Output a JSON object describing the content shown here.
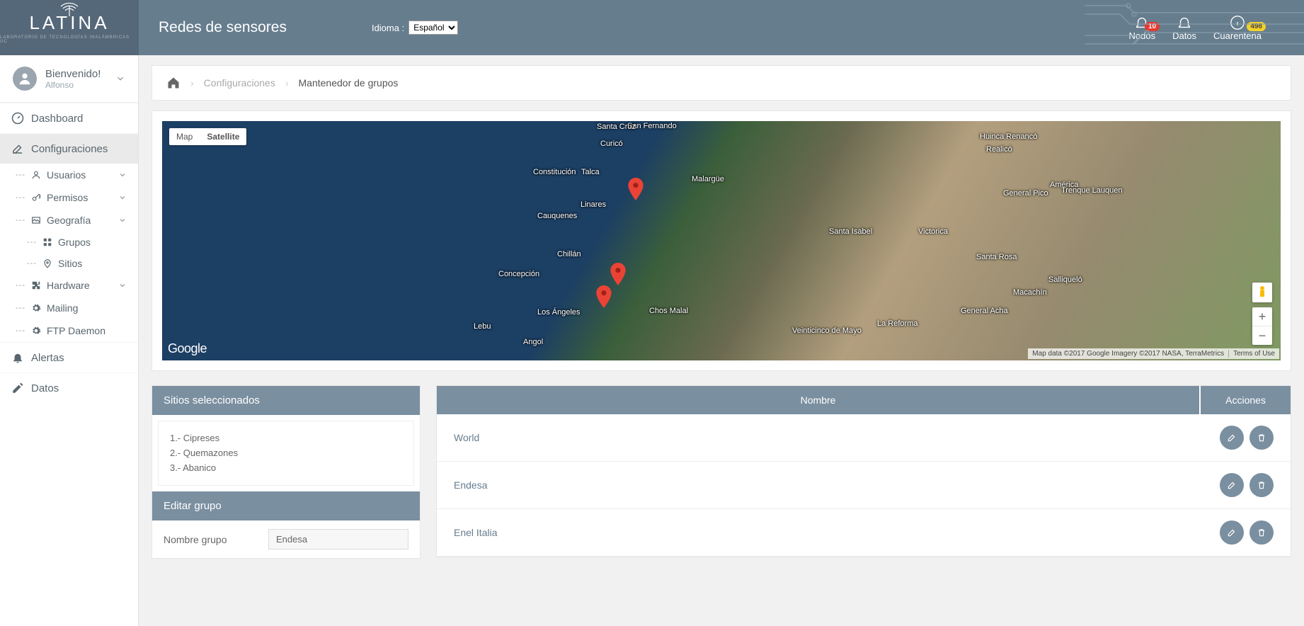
{
  "header": {
    "brand": "LATINA",
    "brand_sub": "LABORATORIO DE TECNOLOGÍAS INALÁMBRICAS UC",
    "title": "Redes de sensores",
    "lang_label": "Idioma :",
    "lang_value": "Español",
    "icons": {
      "nodos": {
        "label": "Nodos",
        "badge": "10"
      },
      "datos": {
        "label": "Datos"
      },
      "cuarentena": {
        "label": "Cuarentena",
        "badge": "498"
      }
    }
  },
  "user": {
    "welcome": "Bienvenido!",
    "name": "Alfonso"
  },
  "nav": {
    "dashboard": "Dashboard",
    "config": "Configuraciones",
    "sub": {
      "usuarios": "Usuarios",
      "permisos": "Permisos",
      "geografia": "Geografía",
      "grupos": "Grupos",
      "sitios": "Sitios",
      "hardware": "Hardware",
      "mailing": "Mailing",
      "ftp": "FTP Daemon"
    },
    "alertas": "Alertas",
    "datos": "Datos"
  },
  "breadcrumb": {
    "a": "Configuraciones",
    "b": "Mantenedor de grupos"
  },
  "map": {
    "type_map": "Map",
    "type_sat": "Satellite",
    "google": "Google",
    "attr": "Map data ©2017 Google Imagery ©2017 NASA, TerraMetrics",
    "terms": "Terms of Use",
    "cities": {
      "sanfernando": "San Fernando",
      "huinca": "Huinca Renancó",
      "realico": "Realicó",
      "curico": "Curicó",
      "constitucion": "Constitución",
      "talca": "Talca",
      "malargue": "Malargüe",
      "america": "América",
      "generalpico": "General Pico",
      "trenque": "Trenque Lauquen",
      "linares": "Linares",
      "cauquenes": "Cauquenes",
      "santaisabel": "Santa Isabel",
      "victorica": "Victorica",
      "chillan": "Chillán",
      "santarosa": "Santa Rosa",
      "salliquelo": "Salliqueló",
      "concepcion": "Concepción",
      "macachin": "Macachín",
      "generalacha": "General Acha",
      "losangeles": "Los Ángeles",
      "chosmalal": "Chos Malal",
      "lebu": "Lebu",
      "angol": "Angol",
      "larefoma": "La Reforma",
      "veinticinco": "Veinticinco de Mayo",
      "santacruz": "Santa Cruz"
    }
  },
  "panel_left": {
    "title_sites": "Sitios seleccionados",
    "sites": [
      "1.- Cipreses",
      "2.- Quemazones",
      "3.- Abanico"
    ],
    "title_edit": "Editar grupo",
    "field_name": "Nombre grupo",
    "field_value": "Endesa"
  },
  "table": {
    "col_name": "Nombre",
    "col_actions": "Acciones",
    "rows": [
      "World",
      "Endesa",
      "Enel Italia"
    ]
  }
}
